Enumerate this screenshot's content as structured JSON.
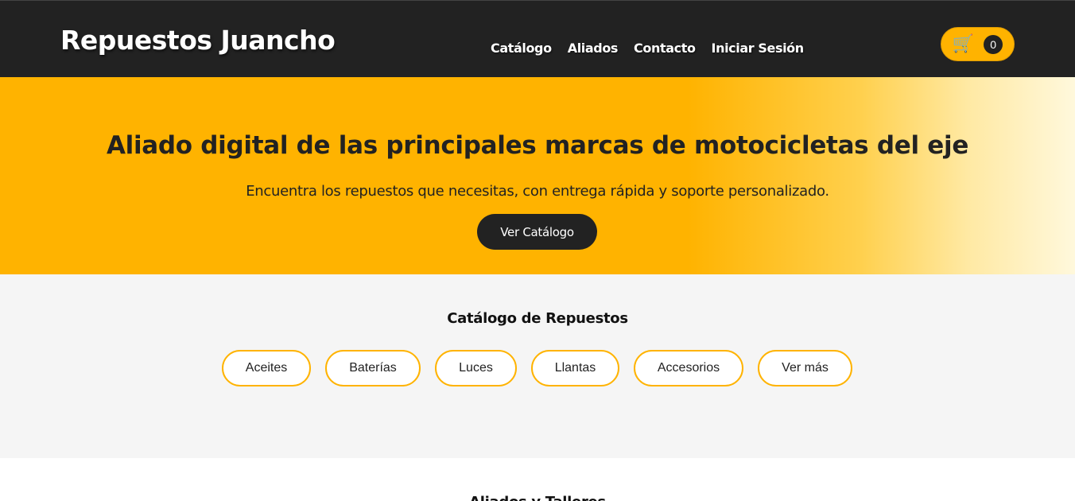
{
  "header": {
    "logo": "Repuestos Juancho",
    "nav": [
      "Catálogo",
      "Aliados",
      "Contacto",
      "Iniciar Sesión"
    ],
    "cart": {
      "icon": "cart-icon",
      "count": "0"
    }
  },
  "hero": {
    "title": "Aliado digital de las principales marcas de motocicletas del eje",
    "subtitle": "Encuentra los repuestos que necesitas, con entrega rápida y soporte personalizado.",
    "button": "Ver Catálogo"
  },
  "catalog": {
    "title": "Catálogo de Repuestos",
    "categories": [
      "Aceites",
      "Baterías",
      "Luces",
      "Llantas",
      "Accesorios",
      "Ver más"
    ]
  },
  "allies": {
    "title": "Aliados y Talleres"
  },
  "colors": {
    "accent": "#ffb300",
    "dark": "#222222",
    "section_bg": "#f5f5f5"
  }
}
